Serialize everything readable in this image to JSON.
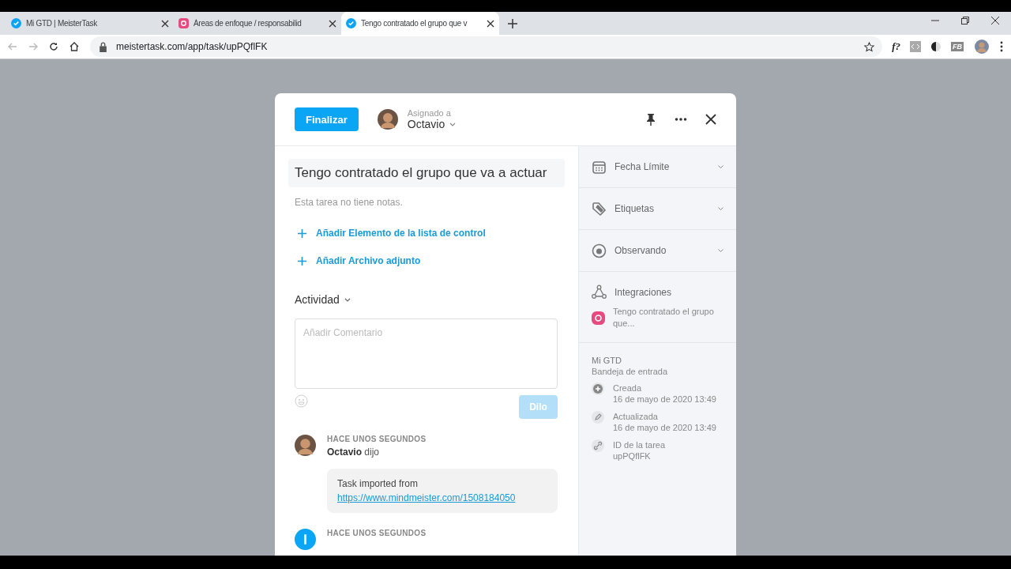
{
  "browser": {
    "tabs": [
      {
        "title": "Mi GTD | MeisterTask",
        "selected": false,
        "kind": "check"
      },
      {
        "title": "Áreas de enfoque / responsabilid",
        "selected": false,
        "kind": "mind"
      },
      {
        "title": "Tengo contratado el grupo que v",
        "selected": true,
        "kind": "check"
      }
    ],
    "url": "meistertask.com/app/task/upPQflFK",
    "extensions": [
      {
        "label": "f?",
        "kind": "text"
      },
      {
        "kind": "code"
      },
      {
        "kind": "contrast"
      },
      {
        "label": "FB",
        "kind": "badge"
      }
    ]
  },
  "task": {
    "finish_button": "Finalizar",
    "assignee_label": "Asignado a",
    "assignee": "Octavio",
    "title": "Tengo contratado el grupo que va a actuar",
    "notes": "Esta tarea no tiene notas.",
    "actions": [
      "Añadir Elemento de la lista de control",
      "Añadir Archivo adjunto"
    ],
    "activity_label": "Actividad",
    "comment": {
      "placeholder": "Añadir Comentario",
      "submit": "Dilo",
      "disabled": true
    },
    "feed": [
      {
        "kind": "comment",
        "time": "HACE UNOS SEGUNDOS",
        "author": "Octavio",
        "verb": "dijo",
        "message": "Task imported from",
        "link": "https://www.mindmeister.com/1508184050"
      },
      {
        "kind": "system",
        "time": "HACE UNOS SEGUNDOS"
      }
    ]
  },
  "sidebar": {
    "sections": [
      {
        "label": "Fecha Límite"
      },
      {
        "label": "Etiquetas"
      },
      {
        "label": "Observando"
      }
    ],
    "integrations": {
      "label": "Integraciones",
      "item": "Tengo contratado el grupo que..."
    },
    "project": "Mi GTD",
    "section": "Bandeja de entrada",
    "meta": [
      {
        "label": "Creada",
        "value": "16 de mayo de 2020 13:49"
      },
      {
        "label": "Actualizada",
        "value": "16 de mayo de 2020 13:49"
      },
      {
        "label": "ID de la tarea",
        "value": "upPQflFK"
      }
    ]
  }
}
